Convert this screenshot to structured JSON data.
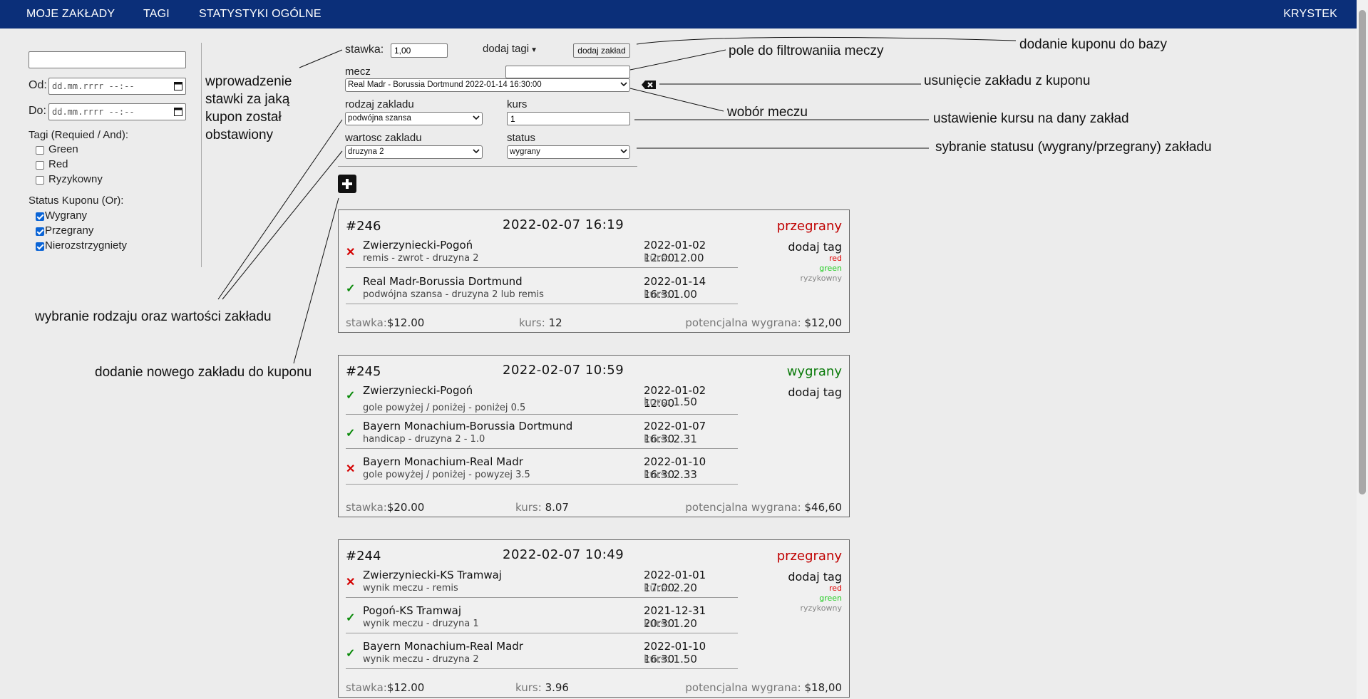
{
  "nav": {
    "items": [
      "MOJE ZAKŁADY",
      "TAGI",
      "STATYSTYKI OGÓLNE"
    ],
    "user": "KRYSTEK",
    "bg_color": "#0b2f79"
  },
  "sidebar": {
    "search_value": "",
    "from_label": "Od:",
    "to_label": "Do:",
    "date_placeholder": "dd.mm.rrrr --:--",
    "tags_heading": "Tagi (Requied / And):",
    "tags": [
      {
        "label": "Green",
        "checked": false
      },
      {
        "label": "Red",
        "checked": false
      },
      {
        "label": "Ryzykowny",
        "checked": false
      }
    ],
    "status_heading": "Status Kuponu (Or):",
    "statuses": [
      {
        "label": "Wygrany",
        "checked": true
      },
      {
        "label": "Przegrany",
        "checked": true
      },
      {
        "label": "Nierozstrzygniety",
        "checked": true
      }
    ]
  },
  "form": {
    "stake_label": "stawka:",
    "stake_value": "1,00",
    "add_tags_label": "dodaj tagi",
    "add_bet_button": "dodaj zakład",
    "match_label": "mecz",
    "match_filter_value": "",
    "match_selected": "Real Madr - Borussia Dortmund   2022-01-14 16:30:00",
    "bet_type_label": "rodzaj zakladu",
    "bet_type_selected": "podwójna szansa",
    "odds_label": "kurs",
    "odds_value": "1",
    "bet_value_label": "wartosc zakladu",
    "bet_value_selected": "druzyna 2",
    "status_label": "status",
    "status_selected": "wygrany"
  },
  "annotations": {
    "stake": [
      "wprowadzenie",
      "stawki za jaką",
      "kupon został",
      "obstawiony"
    ],
    "add_coupon": "dodanie kuponu do bazy",
    "filter": "pole do filtrowaniia meczy",
    "remove": "usunięcie zakładu z kuponu",
    "choose_match": "wobór meczu",
    "set_odds": "ustawienie kursu na dany zakład",
    "set_status": "sybranie statusu (wygrany/przegrany) zakładu",
    "type_value": "wybranie rodzaju oraz wartości zakładu",
    "add_new": "dodanie nowego zakładu do kuponu"
  },
  "coupons": [
    {
      "id": "#246",
      "date": "2022-02-07 16:19",
      "status": "przegrany",
      "status_kind": "lose",
      "add_tag": "dodaj tag",
      "tags": [
        {
          "label": "red",
          "color": "#e00000"
        },
        {
          "label": "green",
          "color": "#22cc22"
        },
        {
          "label": "ryzykowny",
          "color": "#888888"
        }
      ],
      "bets": [
        {
          "result": "lose",
          "match": "Zwierzyniecki-Pogoń",
          "desc": "remis - zwrot - druzyna 2",
          "date": "2022-01-02 12:00",
          "kurs": "12.00"
        },
        {
          "result": "win",
          "match": "Real Madr-Borussia Dortmund",
          "desc": "podwójna szansa - druzyna 2 lub remis",
          "date": "2022-01-14 16:30",
          "kurs": "1.00"
        }
      ],
      "stake_label": "stawka:",
      "stake": "$12.00",
      "kurs_label": "kurs:",
      "kurs": "12",
      "potential_label": "potencjalna wygrana:",
      "potential": "$12,00"
    },
    {
      "id": "#245",
      "date": "2022-02-07 10:59",
      "status": "wygrany",
      "status_kind": "win",
      "add_tag": "dodaj tag",
      "tags": [],
      "bets": [
        {
          "result": "win",
          "match": "Zwierzyniecki-Pogoń",
          "desc": "gole powyżej / poniżej - poniżej 0.5",
          "date": "2022-01-02 12:00",
          "kurs": "1.50"
        },
        {
          "result": "win",
          "match": "Bayern Monachium-Borussia Dortmund",
          "desc": "handicap - druzyna 2 - 1.0",
          "date": "2022-01-07 16:30",
          "kurs": "2.31"
        },
        {
          "result": "lose",
          "match": "Bayern Monachium-Real Madr",
          "desc": "gole powyżej / poniżej - powyzej 3.5",
          "date": "2022-01-10 16:30",
          "kurs": "2.33"
        }
      ],
      "stake_label": "stawka:",
      "stake": "$20.00",
      "kurs_label": "kurs:",
      "kurs": "8.07",
      "potential_label": "potencjalna wygrana:",
      "potential": "$46,60"
    },
    {
      "id": "#244",
      "date": "2022-02-07 10:49",
      "status": "przegrany",
      "status_kind": "lose",
      "add_tag": "dodaj tag",
      "tags": [
        {
          "label": "red",
          "color": "#e00000"
        },
        {
          "label": "green",
          "color": "#22cc22"
        },
        {
          "label": "ryzykowny",
          "color": "#888888"
        }
      ],
      "bets": [
        {
          "result": "lose",
          "match": "Zwierzyniecki-KS Tramwaj",
          "desc": "wynik meczu - remis",
          "date": "2022-01-01 17:00",
          "kurs": "2.20"
        },
        {
          "result": "win",
          "match": "Pogoń-KS Tramwaj",
          "desc": "wynik meczu - druzyna 1",
          "date": "2021-12-31 20:30",
          "kurs": "1.20"
        },
        {
          "result": "win",
          "match": "Bayern Monachium-Real Madr",
          "desc": "wynik meczu - druzyna 2",
          "date": "2022-01-10 16:30",
          "kurs": "1.50"
        }
      ],
      "stake_label": "stawka:",
      "stake": "$12.00",
      "kurs_label": "kurs:",
      "kurs": "3.96",
      "potential_label": "potencjalna wygrana:",
      "potential": "$18,00"
    }
  ]
}
